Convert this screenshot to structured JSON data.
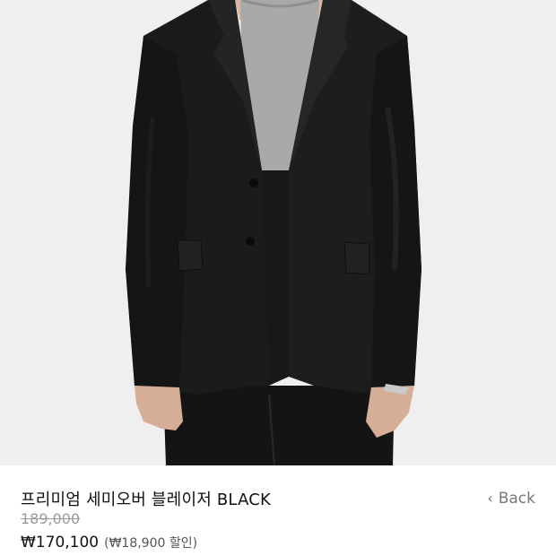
{
  "product": {
    "name": "프리미엄 세미오버 블레이저 BLACK",
    "original_price": "189,000",
    "sale_price": "₩170,100",
    "discount_note": "(₩18,900 할인)"
  },
  "nav": {
    "back_label": "Back",
    "back_icon": "chevron-left-icon"
  },
  "image": {
    "subject": "black semi-oversized blazer over grey knit, black trousers",
    "background_color": "#efefef"
  }
}
